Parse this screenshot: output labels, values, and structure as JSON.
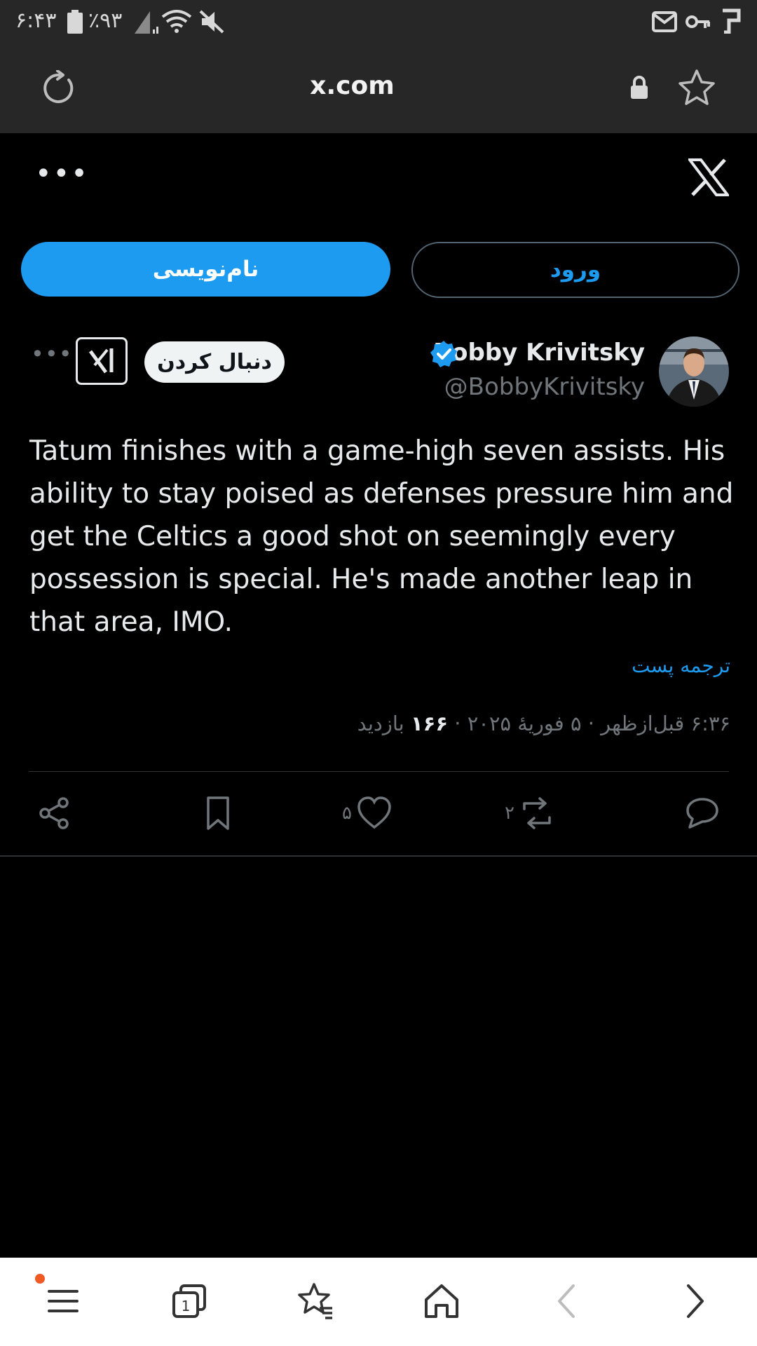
{
  "status_bar": {
    "time": "۶:۴۳",
    "battery": "٪۹۳"
  },
  "browser": {
    "url": "x.com"
  },
  "auth": {
    "signup_label": "نام‌نویسی",
    "login_label": "ورود"
  },
  "tweet": {
    "display_name": "Bobby Krivitsky",
    "handle": "@BobbyKrivitsky",
    "follow_label": "دنبال کردن",
    "text": "Tatum finishes with a game-high seven assists. His ability to stay poised as defenses pressure him and get the Celtics a good shot on seemingly every possession is special. He's made another leap in that area, IMO.",
    "translate_label": "ترجمه پست",
    "timestamp": "۶:۳۶ قبل‌ازظهر · ۵ فوریهٔ ۲۰۲۵ ·",
    "views_count": "۱۶۶",
    "views_label": "بازدید",
    "likes": "۵",
    "reposts": "۲"
  },
  "colors": {
    "accent": "#1d9bf0",
    "background": "#000000",
    "chrome": "#272727"
  },
  "icons": [
    "refresh-icon",
    "lock-icon",
    "star-icon",
    "x-logo-icon",
    "grok-icon",
    "verified-icon",
    "share-icon",
    "bookmark-icon",
    "heart-icon",
    "repost-icon",
    "reply-icon",
    "menu-icon",
    "tabs-icon",
    "bookmarks-icon",
    "home-icon",
    "back-icon",
    "forward-icon"
  ]
}
